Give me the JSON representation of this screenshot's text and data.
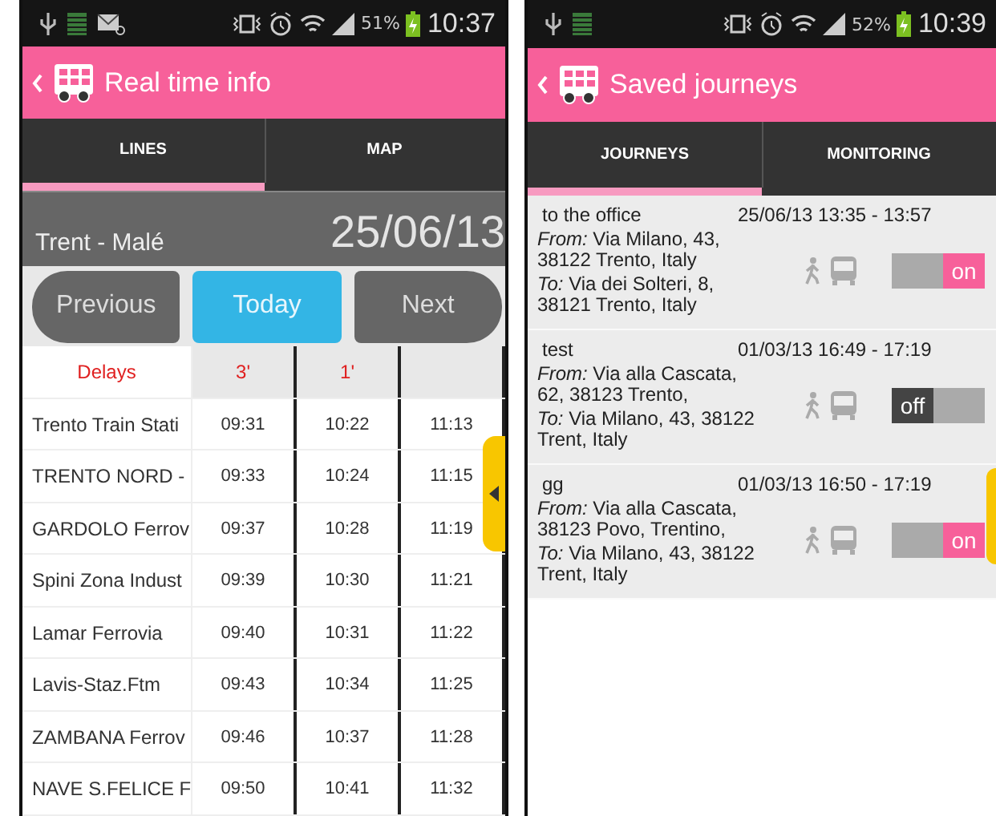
{
  "screens": [
    {
      "kind": "timetable",
      "status_bar": {
        "icons": [
          {
            "kind": "usb"
          },
          {
            "kind": "storage"
          },
          {
            "kind": "mail"
          }
        ],
        "battery": "51%",
        "time": "10:37"
      },
      "title": "Real time info",
      "tabs": [
        {
          "label": "LINES",
          "selected": true
        },
        {
          "label": "MAP",
          "selected": false
        }
      ],
      "line": "Trent - Malé",
      "date": "25/06/13",
      "buttons": [
        {
          "label": "Previous",
          "selected": false
        },
        {
          "label": "Today",
          "selected": true
        },
        {
          "label": "Next",
          "selected": false
        }
      ],
      "table": {
        "header": [
          "Delays",
          "3'",
          "1'"
        ],
        "rows": [
          {
            "stop": "Trento Train Stati",
            "times": [
              "09:31",
              "10:22",
              "11:13"
            ]
          },
          {
            "stop": "TRENTO NORD -",
            "times": [
              "09:33",
              "10:24",
              "11:15"
            ]
          },
          {
            "stop": "GARDOLO Ferrov",
            "times": [
              "09:37",
              "10:28",
              "11:19"
            ]
          },
          {
            "stop": "Spini Zona Indust",
            "times": [
              "09:39",
              "10:30",
              "11:21"
            ]
          },
          {
            "stop": "Lamar Ferrovia",
            "times": [
              "09:40",
              "10:31",
              "11:22"
            ]
          },
          {
            "stop": "Lavis-Staz.Ftm",
            "times": [
              "09:43",
              "10:34",
              "11:25"
            ]
          },
          {
            "stop": "ZAMBANA Ferrov",
            "times": [
              "09:46",
              "10:37",
              "11:28"
            ]
          },
          {
            "stop": "NAVE S.FELICE F",
            "times": [
              "09:50",
              "10:41",
              "11:32"
            ]
          }
        ]
      }
    },
    {
      "kind": "journeys",
      "status_bar": {
        "icons": [
          {
            "kind": "usb"
          },
          {
            "kind": "storage"
          }
        ],
        "battery": "52%",
        "time": "10:39"
      },
      "title": "Saved journeys",
      "tabs": [
        {
          "label": "JOURNEYS",
          "selected": true
        },
        {
          "label": "MONITORING",
          "selected": false
        }
      ],
      "journeys": [
        {
          "name": "to the office",
          "time": "25/06/13 13:35 - 13:57",
          "from": "*From:* Via Milano, 43, 38122 Trento, Italy",
          "to": "*To:* Via dei Solteri, 8, 38121 Trento, Italy",
          "toggle": "on",
          "on": true
        },
        {
          "name": "test",
          "time": "01/03/13 16:49 - 17:19",
          "from": "*From:* Via alla Cascata, 62, 38123 Trento,",
          "to": "*To:* Via Milano, 43, 38122 Trent, Italy",
          "toggle": "off",
          "on": false
        },
        {
          "name": "gg",
          "time": "01/03/13 16:50 - 17:19",
          "from": "*From:* Via alla Cascata, 38123 Povo, Trentino,",
          "to": "*To:* Via Milano, 43, 38122 Trent, Italy",
          "toggle": "on",
          "on": true
        }
      ]
    }
  ]
}
